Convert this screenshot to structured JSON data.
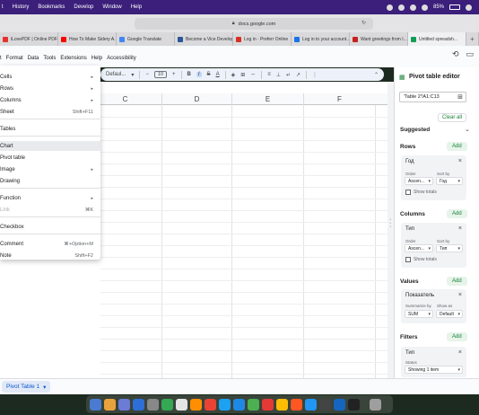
{
  "menubar": {
    "items": [
      "t",
      "History",
      "Bookmarks",
      "Develop",
      "Window",
      "Help"
    ],
    "battery": "85%"
  },
  "browser": {
    "url": "docs.google.com",
    "tabs": [
      {
        "label": "iLovePDF | Online PDF...",
        "color": "#e5322d"
      },
      {
        "label": "How To Make Sidery A...",
        "color": "#ff0000"
      },
      {
        "label": "Google Translate",
        "color": "#4285f4"
      },
      {
        "label": "Become a Vice Develop...",
        "color": "#2b5797"
      },
      {
        "label": "Log in · Preferr Online",
        "color": "#d93025"
      },
      {
        "label": "Log in to your account...",
        "color": "#1a73e8"
      },
      {
        "label": "Want greetings from I...",
        "color": "#c5221f"
      },
      {
        "label": "Untitled spreadsh...",
        "color": "#0f9d58"
      }
    ]
  },
  "sheets": {
    "menu": [
      "t",
      "Format",
      "Data",
      "Tools",
      "Extensions",
      "Help",
      "Accessibility"
    ],
    "toolbar": {
      "font": "Defaul...",
      "size": "10"
    },
    "columns": [
      "C",
      "D",
      "E",
      "F"
    ]
  },
  "insert_menu": {
    "items": [
      {
        "label": "Cells",
        "arrow": true
      },
      {
        "label": "Rows",
        "arrow": true
      },
      {
        "label": "Columns",
        "arrow": true
      },
      {
        "label": "Sheet",
        "shortcut": "Shift+F11"
      },
      {
        "label": "Tables"
      },
      {
        "label": "Chart",
        "highlight": true
      },
      {
        "label": "Pivot table"
      },
      {
        "label": "Image",
        "arrow": true
      },
      {
        "label": "Drawing"
      },
      {
        "label": "Function",
        "arrow": true
      },
      {
        "label": "Link",
        "shortcut": "⌘K",
        "disabled": true
      },
      {
        "label": "Checkbox"
      },
      {
        "label": "Comment",
        "shortcut": "⌘+Option+M"
      },
      {
        "label": "Note",
        "shortcut": "Shift+F2"
      }
    ]
  },
  "pivot_editor": {
    "title": "Pivot table editor",
    "range": "'Table 2'!A1:C13",
    "clear_all": "Clear all",
    "suggested": "Suggested",
    "add": "Add",
    "rows": {
      "section": "Rows",
      "field": "Год",
      "order_label": "Order",
      "order_value": "Ascen...",
      "sort_label": "Sort by",
      "sort_value": "Год",
      "show_totals": "Show totals"
    },
    "columns": {
      "section": "Columns",
      "field": "Тип",
      "order_label": "Order",
      "order_value": "Ascen...",
      "sort_label": "Sort by",
      "sort_value": "Тип",
      "show_totals": "Show totals"
    },
    "values": {
      "section": "Values",
      "field": "Показатель",
      "summarize_label": "Summarize by",
      "summarize_value": "SUM",
      "show_as_label": "Show as",
      "show_as_value": "Default"
    },
    "filters": {
      "section": "Filters",
      "field": "Тип",
      "status_label": "Status",
      "status_value": "Showing 1 item"
    }
  },
  "sheet_tab": "Pivot Table 1"
}
